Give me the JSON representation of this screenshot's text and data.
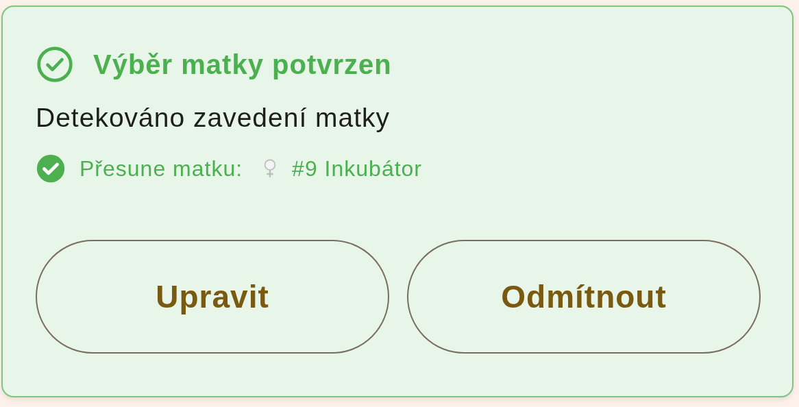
{
  "card": {
    "title": "Výběr matky potvrzen",
    "message": "Detekováno zavedení matky",
    "detail": {
      "label": "Přesune matku:",
      "value": "#9 Inkubátor"
    },
    "buttons": [
      "Upravit",
      "Odmítnout"
    ]
  }
}
